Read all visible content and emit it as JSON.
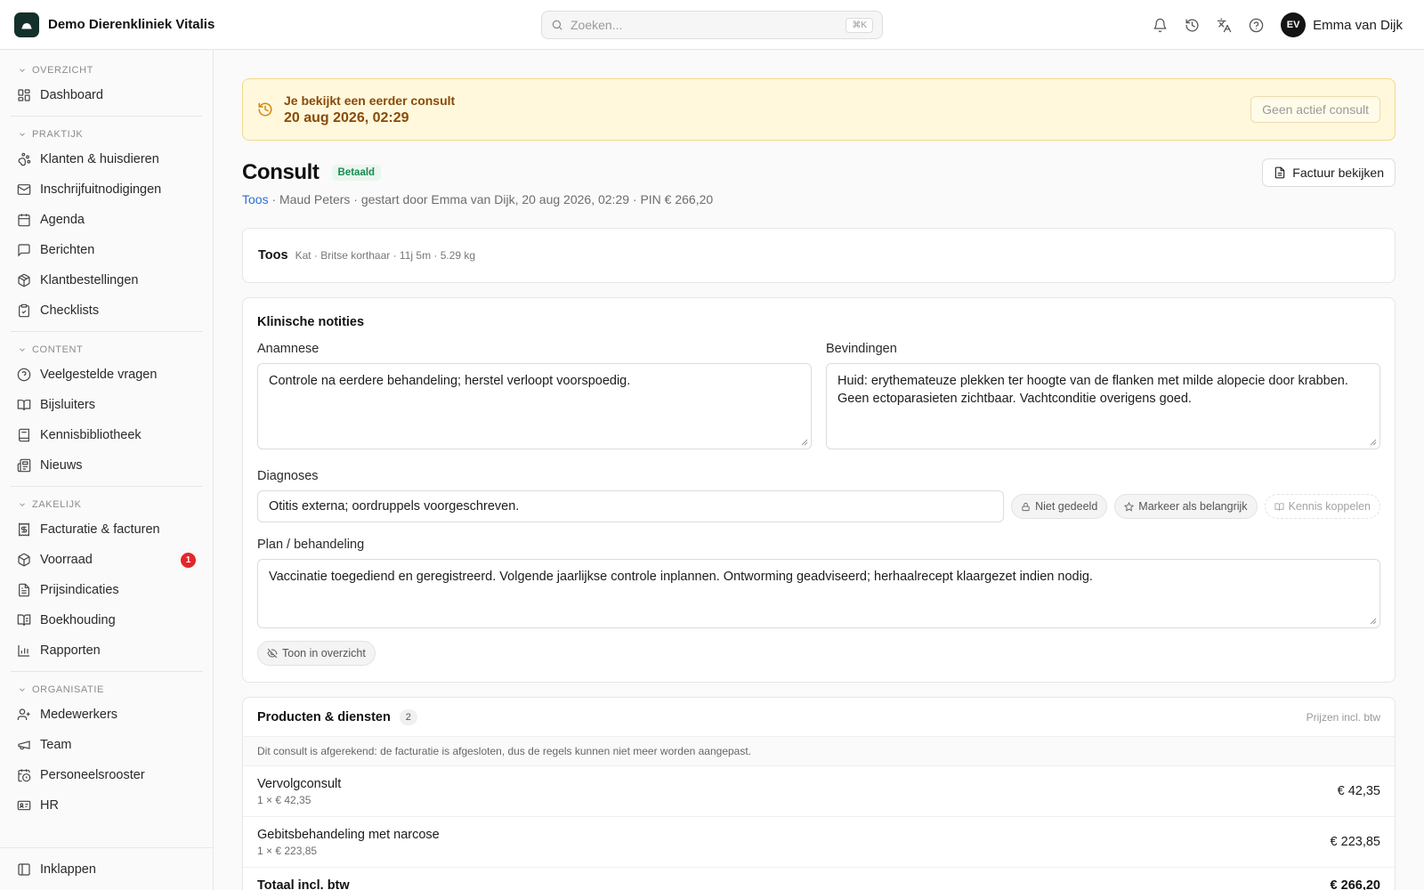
{
  "app": {
    "name": "Demo Dierenkliniek Vitalis"
  },
  "search": {
    "placeholder": "Zoeken...",
    "shortcut": "⌘K"
  },
  "header": {
    "icons": [
      "bell-icon",
      "history-icon",
      "translate-icon",
      "help-icon"
    ],
    "user": {
      "initials": "EV",
      "name": "Emma van Dijk"
    }
  },
  "sidebar": {
    "sections": [
      {
        "title": "OVERZICHT",
        "items": [
          {
            "label": "Dashboard",
            "icon": "dashboard-icon"
          }
        ]
      },
      {
        "title": "PRAKTIJK",
        "items": [
          {
            "label": "Klanten & huisdieren",
            "icon": "paw-icon"
          },
          {
            "label": "Inschrijfuitnodigingen",
            "icon": "mail-icon"
          },
          {
            "label": "Agenda",
            "icon": "calendar-icon"
          },
          {
            "label": "Berichten",
            "icon": "message-icon"
          },
          {
            "label": "Klantbestellingen",
            "icon": "package-icon"
          },
          {
            "label": "Checklists",
            "icon": "clipboard-icon"
          }
        ]
      },
      {
        "title": "CONTENT",
        "items": [
          {
            "label": "Veelgestelde vragen",
            "icon": "help-circle-icon"
          },
          {
            "label": "Bijsluiters",
            "icon": "book-open-icon"
          },
          {
            "label": "Kennisbibliotheek",
            "icon": "book-icon"
          },
          {
            "label": "Nieuws",
            "icon": "newspaper-icon"
          }
        ]
      },
      {
        "title": "ZAKELIJK",
        "items": [
          {
            "label": "Facturatie & facturen",
            "icon": "receipt-icon"
          },
          {
            "label": "Voorraad",
            "icon": "box-icon",
            "badge": "1"
          },
          {
            "label": "Prijsindicaties",
            "icon": "file-text-icon"
          },
          {
            "label": "Boekhouding",
            "icon": "ledger-icon"
          },
          {
            "label": "Rapporten",
            "icon": "bar-chart-icon"
          }
        ]
      },
      {
        "title": "ORGANISATIE",
        "items": [
          {
            "label": "Medewerkers",
            "icon": "users-icon"
          },
          {
            "label": "Team",
            "icon": "megaphone-icon"
          },
          {
            "label": "Personeelsrooster",
            "icon": "calendar-clock-icon"
          },
          {
            "label": "HR",
            "icon": "id-card-icon"
          }
        ]
      }
    ],
    "collapse_label": "Inklappen"
  },
  "alert": {
    "line1": "Je bekijkt een eerder consult",
    "line2": "20 aug 2026, 02:29",
    "button": "Geen actief consult"
  },
  "consult": {
    "title": "Consult",
    "status": "Betaald",
    "invoice_button": "Factuur bekijken",
    "meta_pet_link": "Toos",
    "meta_rest": " · Maud Peters · gestart door Emma van Dijk, 20 aug 2026, 02:29 · PIN € 266,20"
  },
  "pet": {
    "name": "Toos",
    "details": "Kat · Britse korthaar · 11j 5m · 5.29 kg"
  },
  "notes": {
    "title": "Klinische notities",
    "anamnese_label": "Anamnese",
    "anamnese": "Controle na eerdere behandeling; herstel verloopt voorspoedig.",
    "bevindingen_label": "Bevindingen",
    "bevindingen": "Huid: erythemateuze plekken ter hoogte van de flanken met milde alopecie door krabben. Geen ectoparasieten zichtbaar. Vachtconditie overigens goed.",
    "diagnoses_label": "Diagnoses",
    "diagnoses": "Otitis externa; oordruppels voorgeschreven.",
    "not_shared": "Niet gedeeld",
    "mark_important": "Markeer als belangrijk",
    "link_knowledge": "Kennis koppelen",
    "plan_label": "Plan / behandeling",
    "plan": "Vaccinatie toegediend en geregistreerd. Volgende jaarlijkse controle inplannen. Ontworming geadviseerd; herhaalrecept klaargezet indien nodig.",
    "show_overview": "Toon in overzicht"
  },
  "products": {
    "title": "Producten & diensten",
    "count": "2",
    "price_note": "Prijzen incl. btw",
    "locked_note": "Dit consult is afgerekend: de facturatie is afgesloten, dus de regels kunnen niet meer worden aangepast.",
    "lines": [
      {
        "name": "Vervolgconsult",
        "qty": "1 × € 42,35",
        "amount": "€ 42,35"
      },
      {
        "name": "Gebitsbehandeling met narcose",
        "qty": "1 × € 223,85",
        "amount": "€ 223,85"
      }
    ],
    "total_label": "Totaal incl. btw",
    "total_amount": "€ 266,20"
  }
}
